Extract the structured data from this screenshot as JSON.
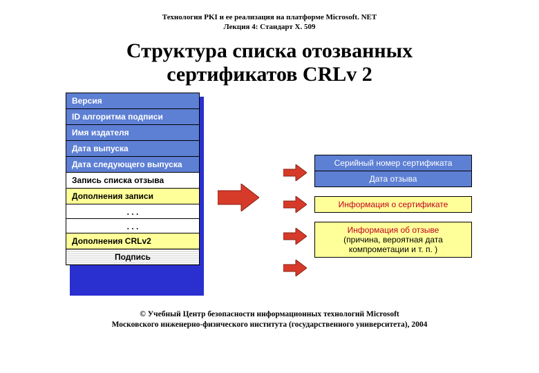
{
  "header": {
    "line1": "Технология PKI и ее реализация на платформе Microsoft. NET",
    "line2": "Лекция 4: Стандарт X. 509"
  },
  "title": {
    "line1": "Структура списка отозванных",
    "line2": "сертификатов CRLv 2"
  },
  "left": {
    "items": [
      "Версия",
      "ID алгоритма подписи",
      "Имя издателя",
      "Дата выпуска",
      "Дата следующего выпуска",
      "Запись списка  отзыва",
      "Дополнения записи",
      ". . .",
      ". . .",
      "Дополнения  CRLv2",
      "Подпись"
    ]
  },
  "right": {
    "r1": "Серийный  номер сертификата",
    "r2": "Дата отзыва",
    "r3": "Информация о сертификате",
    "r4a": "Информация об отзыве",
    "r4b": "(причина, вероятная дата",
    "r4c": "компрометации и т. п. )"
  },
  "footer": {
    "line1": "© Учебный Центр безопасности информационных технологий Microsoft",
    "line2": "Московского инженерно-физического института (государственного университета), 2004"
  }
}
